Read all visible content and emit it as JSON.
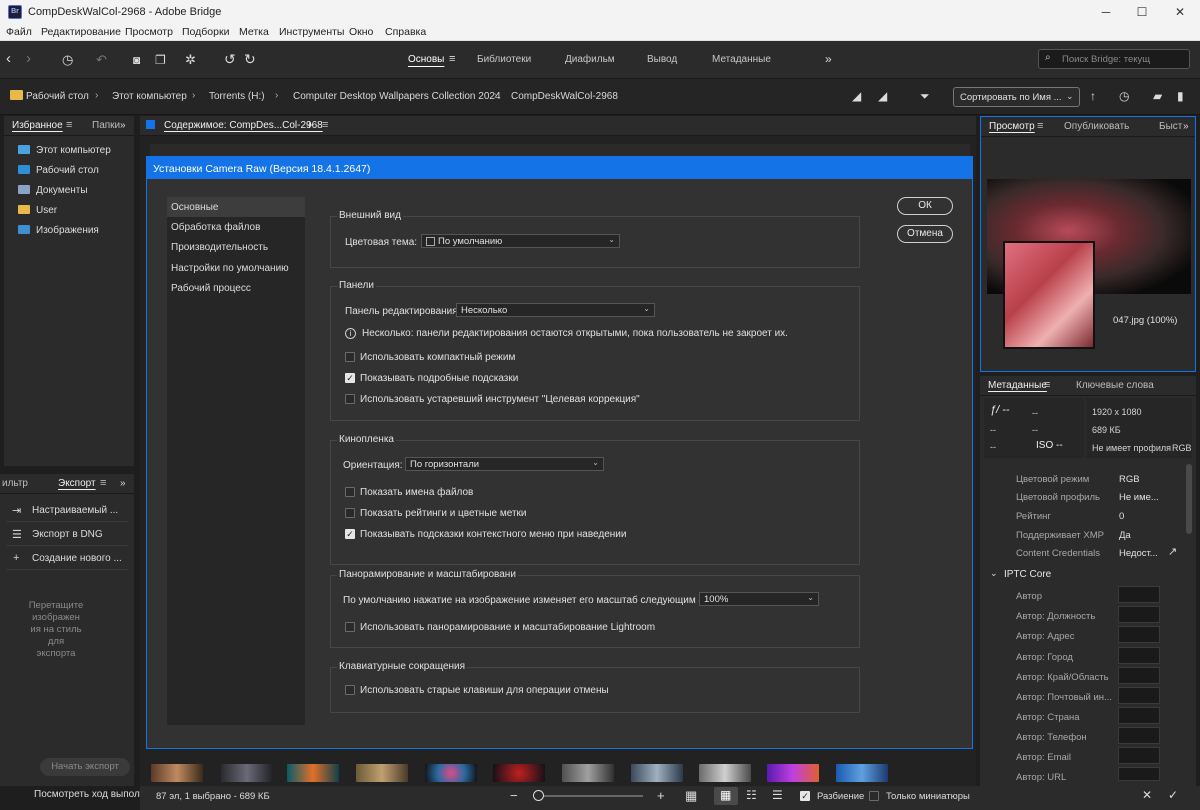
{
  "window": {
    "title": "CompDeskWalCol-2968 - Adobe Bridge",
    "logo": "Br",
    "controls": [
      "─",
      "☐",
      "✕"
    ]
  },
  "menu": [
    "Файл",
    "Редактирование",
    "Просмотр",
    "Подборки",
    "Метка",
    "Инструменты",
    "Окно",
    "Справка"
  ],
  "workspaces": [
    "Основы",
    "Библиотеки",
    "Диафильм",
    "Вывод",
    "Метаданные"
  ],
  "search": {
    "placeholder": "Поиск Bridge: текущ"
  },
  "breadcrumb": [
    "Рабочий стол",
    "Этот компьютер",
    "Torrents (H:)",
    "Computer Desktop Wallpapers Collection 2024",
    "CompDeskWalCol-2968"
  ],
  "sort_label": "Сортировать по Имя ...",
  "left_panel": {
    "tabs": [
      "Избранное",
      "Папки"
    ],
    "favorites": [
      "Этот компьютер",
      "Рабочий стол",
      "Документы",
      "User",
      "Изображения"
    ],
    "lower_tabs": [
      "ильтр",
      "Экспорт"
    ],
    "export_items": [
      "Настраиваемый ...",
      "Экспорт в DNG",
      "Создание нового ..."
    ],
    "drop_hint": [
      "Перетащите",
      "изображен",
      "ия на стиль",
      "для",
      "экспорта"
    ],
    "start_export": "Начать экспорт",
    "bottom_text": "Посмотреть ход выпол"
  },
  "content": {
    "tab": "Содержимое: CompDes...Col-2968"
  },
  "right_panel": {
    "tabs": [
      "Просмотр",
      "Опубликовать",
      "Быст"
    ],
    "preview_caption": "047.jpg (100%)",
    "meta_tabs": [
      "Метаданные",
      "Ключевые слова"
    ],
    "exif": {
      "f": "ƒ/ --",
      "dash": "--",
      "iso": "ISO --",
      "dims": "1920 x 1080",
      "size": "689 КБ",
      "profile": "Не имеет профиля",
      "mode": "RGB"
    },
    "file_props": [
      {
        "label": "Цветовой режим",
        "value": "RGB"
      },
      {
        "label": "Цветовой профиль",
        "value": "Не име..."
      },
      {
        "label": "Рейтинг",
        "value": "0"
      },
      {
        "label": "Поддерживает XMP",
        "value": "Да"
      },
      {
        "label": "Content Credentials",
        "value": "Недост..."
      }
    ],
    "iptc_title": "IPTC Core",
    "iptc_fields": [
      "Автор",
      "Автор: Должность",
      "Автор: Адрес",
      "Автор: Город",
      "Автор: Край/Область",
      "Автор: Почтовый ин...",
      "Автор: Страна",
      "Автор: Телефон",
      "Автор: Email",
      "Автор: URL"
    ]
  },
  "status": {
    "count": "87 эл, 1 выбрано - 689 КБ",
    "split_label": "Разбиение",
    "thumbs_only": "Только миниатюры"
  },
  "dialog": {
    "title": "Установки Camera Raw  (Версия 18.4.1.2647)",
    "nav": [
      "Основные",
      "Обработка файлов",
      "Производительность",
      "Настройки по умолчанию",
      "Рабочий процесс"
    ],
    "ok": "ОК",
    "cancel": "Отмена",
    "appearance": {
      "title": "Внешний вид",
      "theme_label": "Цветовая тема:",
      "theme_value": "По умолчанию"
    },
    "panels": {
      "title": "Панели",
      "edit_label": "Панель редактирования:",
      "edit_value": "Несколько",
      "info": "Несколько: панели редактирования остаются открытыми, пока пользователь не закроет их.",
      "opt1": "Использовать компактный режим",
      "opt2": "Показывать подробные подсказки",
      "opt3": "Использовать устаревший инструмент \"Целевая коррекция\""
    },
    "filmstrip": {
      "title": "Кинопленка",
      "orient_label": "Ориентация:",
      "orient_value": "По горизонтали",
      "opt1": "Показать имена файлов",
      "opt2": "Показать рейтинги и цветные метки",
      "opt3": "Показывать подсказки контекстного меню при наведении"
    },
    "zoom": {
      "title": "Панорамирование и масштабировани",
      "click_label": "По умолчанию нажатие на изображение изменяет его масштаб следующим образо",
      "click_value": "100%",
      "opt1": "Использовать панорамирование и масштабирование Lightroom"
    },
    "shortcuts": {
      "title": "Клавиатурные сокращения",
      "opt1": "Использовать старые клавиши для операции отмены"
    }
  },
  "colors": {
    "accent": "#1473e6",
    "panel": "#2b2b2b",
    "background": "#1e1e1e"
  }
}
